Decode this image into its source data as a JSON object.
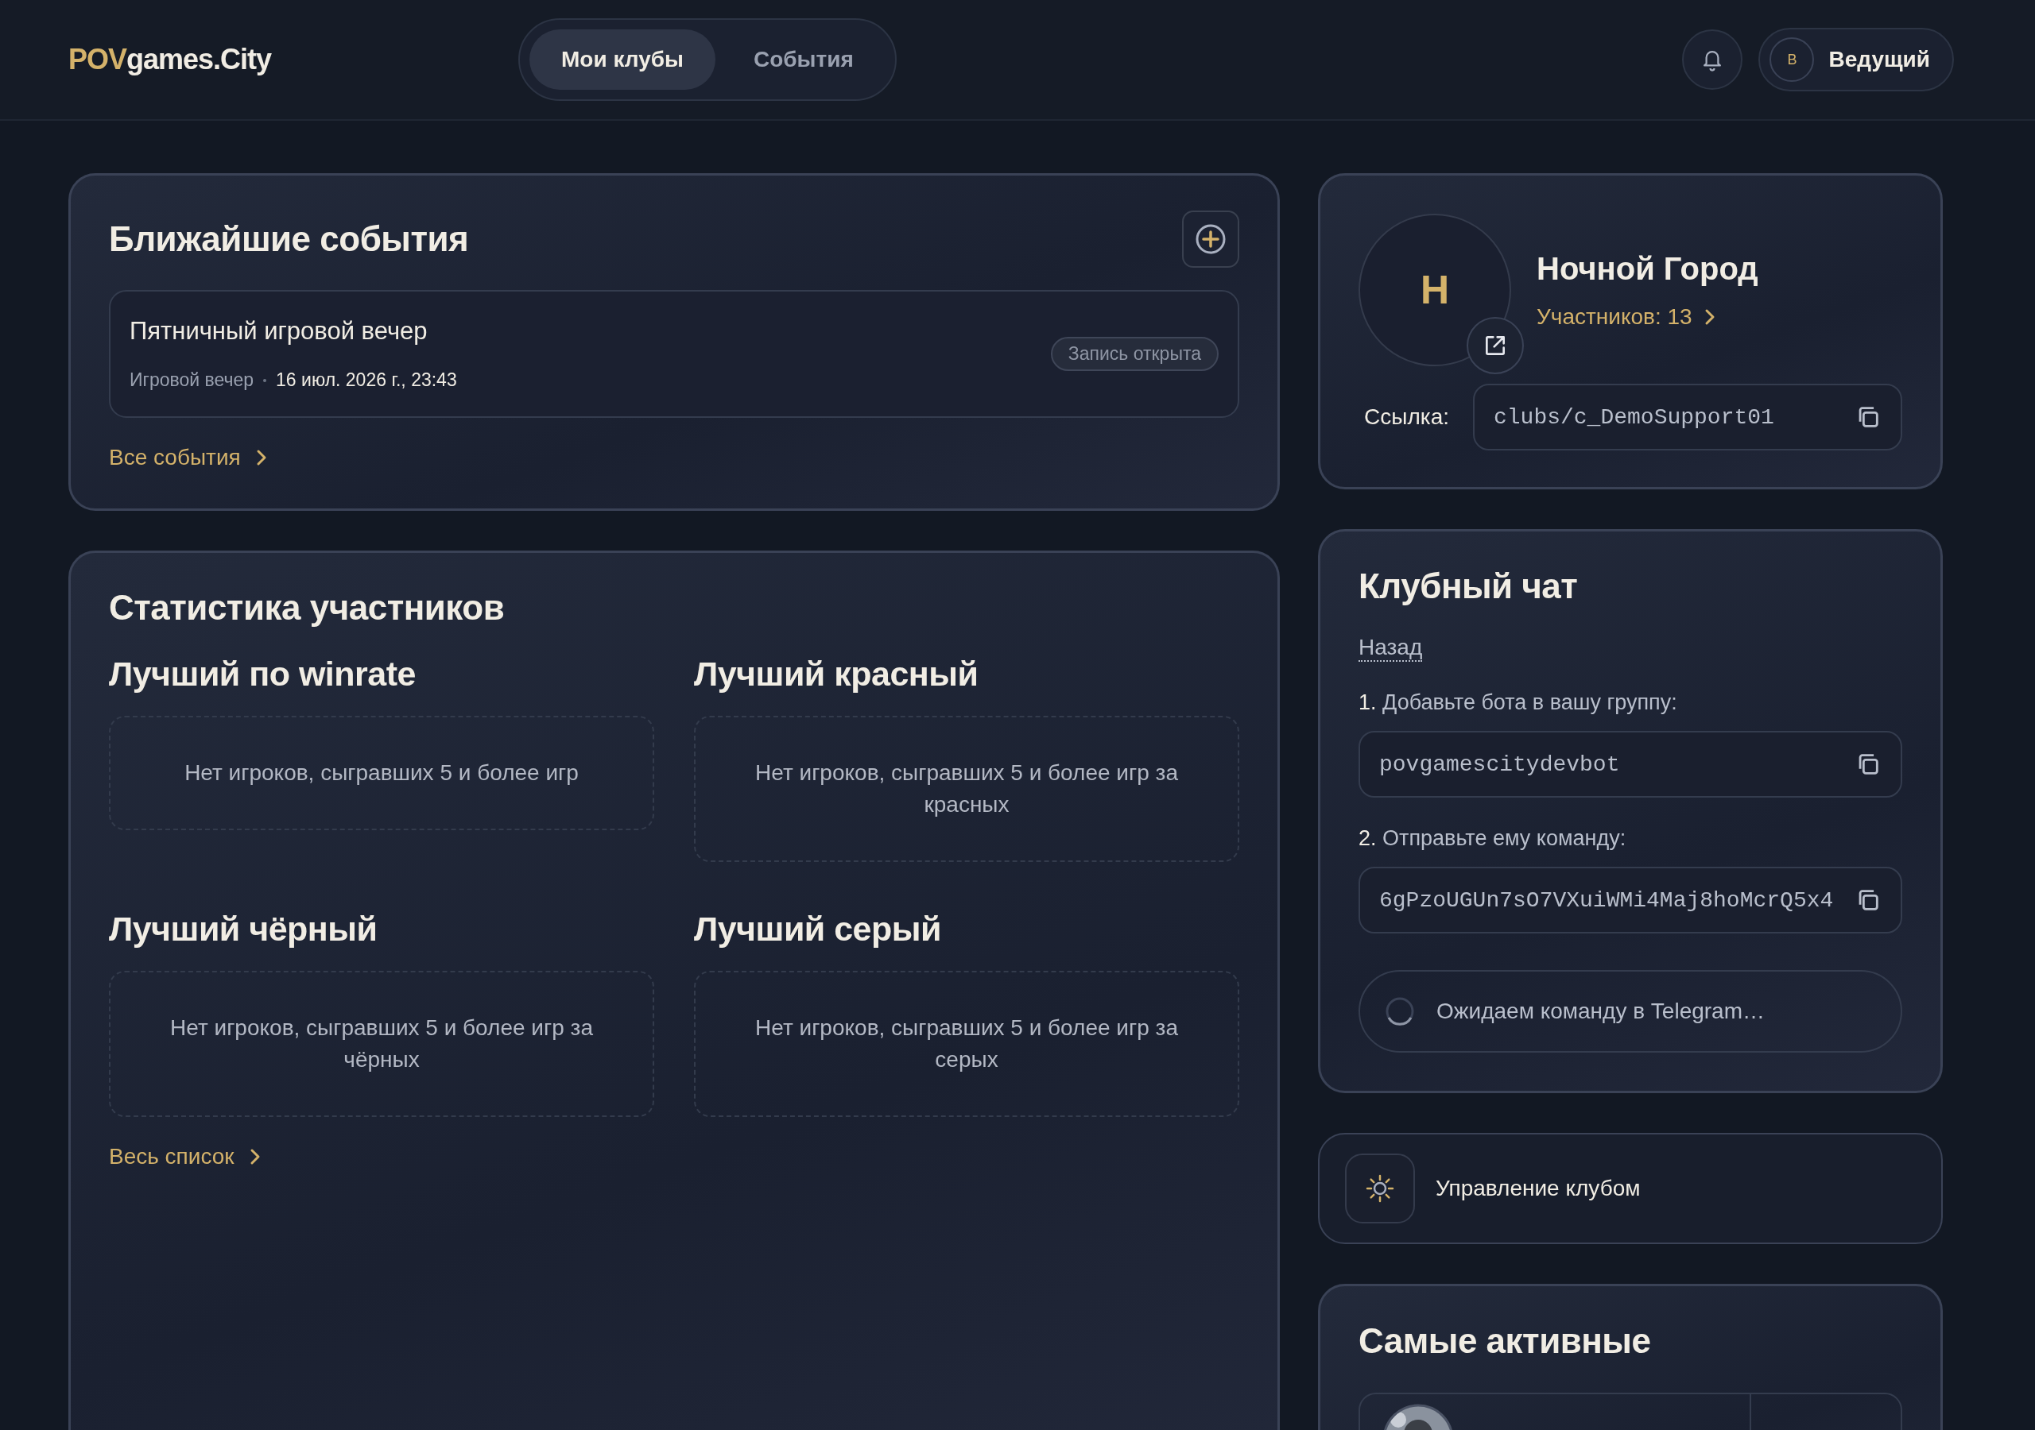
{
  "header": {
    "logo_accent": "POV",
    "logo_rest": "games.City",
    "tabs": [
      {
        "label": "Мои клубы",
        "selected": true
      },
      {
        "label": "События",
        "selected": false
      }
    ],
    "user": {
      "initial": "В",
      "name": "Ведущий"
    }
  },
  "events": {
    "title": "Ближайшие события",
    "items": [
      {
        "title": "Пятничный игровой вечер",
        "type": "Игровой вечер",
        "date": "16 июл. 2026 г., 23:43",
        "status": "Запись открыта"
      }
    ],
    "link": "Все события"
  },
  "stats": {
    "title": "Статистика участников",
    "sections": [
      {
        "title": "Лучший по winrate",
        "empty": "Нет игроков, сыгравших 5 и более игр"
      },
      {
        "title": "Лучший красный",
        "empty": "Нет игроков, сыгравших 5 и более игр за красных"
      },
      {
        "title": "Лучший чёрный",
        "empty": "Нет игроков, сыгравших 5 и более игр за чёрных"
      },
      {
        "title": "Лучший серый",
        "empty": "Нет игроков, сыгравших 5 и более игр за серых"
      }
    ],
    "link": "Весь список"
  },
  "club": {
    "initial": "Н",
    "name": "Ночной Город",
    "members": "Участников: 13",
    "link_label": "Ссылка:",
    "link_value": "clubs/c_DemoSupport01"
  },
  "chat": {
    "title": "Клубный чат",
    "back": "Назад",
    "steps": [
      {
        "number": "1.",
        "text": "Добавьте бота в вашу группу:",
        "value": "povgamescitydevbot"
      },
      {
        "number": "2.",
        "text": "Отправьте ему команду:",
        "value": "6gPzoUGUn7sO7VXuiWMi4Maj8hoMcrQ5x4"
      }
    ],
    "status": "Ожидаем команду в Telegram…"
  },
  "manage": {
    "label": "Управление клубом"
  },
  "active": {
    "title": "Самые активные"
  }
}
